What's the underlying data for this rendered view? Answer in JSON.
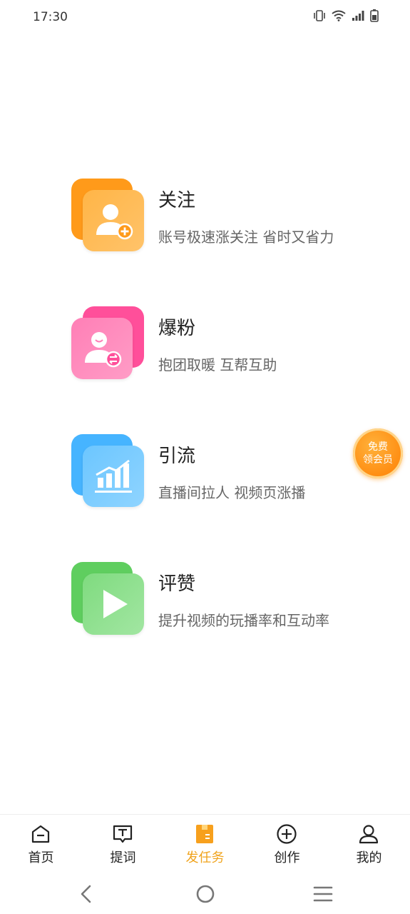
{
  "status_bar": {
    "time": "17:30"
  },
  "tasks": [
    {
      "title": "关注",
      "desc": "账号极速涨关注 省时又省力",
      "color_back": "#ff9a1a",
      "color_front": "#ffb547",
      "icon": "user-plus-icon"
    },
    {
      "title": "爆粉",
      "desc": "抱团取暖 互帮互助",
      "color_back": "#ff4f9a",
      "color_front": "#ff7fb6",
      "icon": "user-exchange-icon"
    },
    {
      "title": "引流",
      "desc": "直播间拉人 视频页涨播",
      "color_back": "#46b4ff",
      "color_front": "#6cc6ff",
      "icon": "chart-growth-icon"
    },
    {
      "title": "评赞",
      "desc": "提升视频的玩播率和互动率",
      "color_back": "#5fce5f",
      "color_front": "#7fdb7f",
      "icon": "play-icon"
    }
  ],
  "vip_badge": {
    "line1": "免费",
    "line2": "领会员"
  },
  "tab_bar": {
    "items": [
      {
        "label": "首页",
        "icon": "home-icon"
      },
      {
        "label": "提词",
        "icon": "teleprompter-icon"
      },
      {
        "label": "发任务",
        "icon": "task-icon",
        "active": true
      },
      {
        "label": "创作",
        "icon": "plus-circle-icon"
      },
      {
        "label": "我的",
        "icon": "profile-icon"
      }
    ],
    "active_color": "#f0a31c"
  }
}
